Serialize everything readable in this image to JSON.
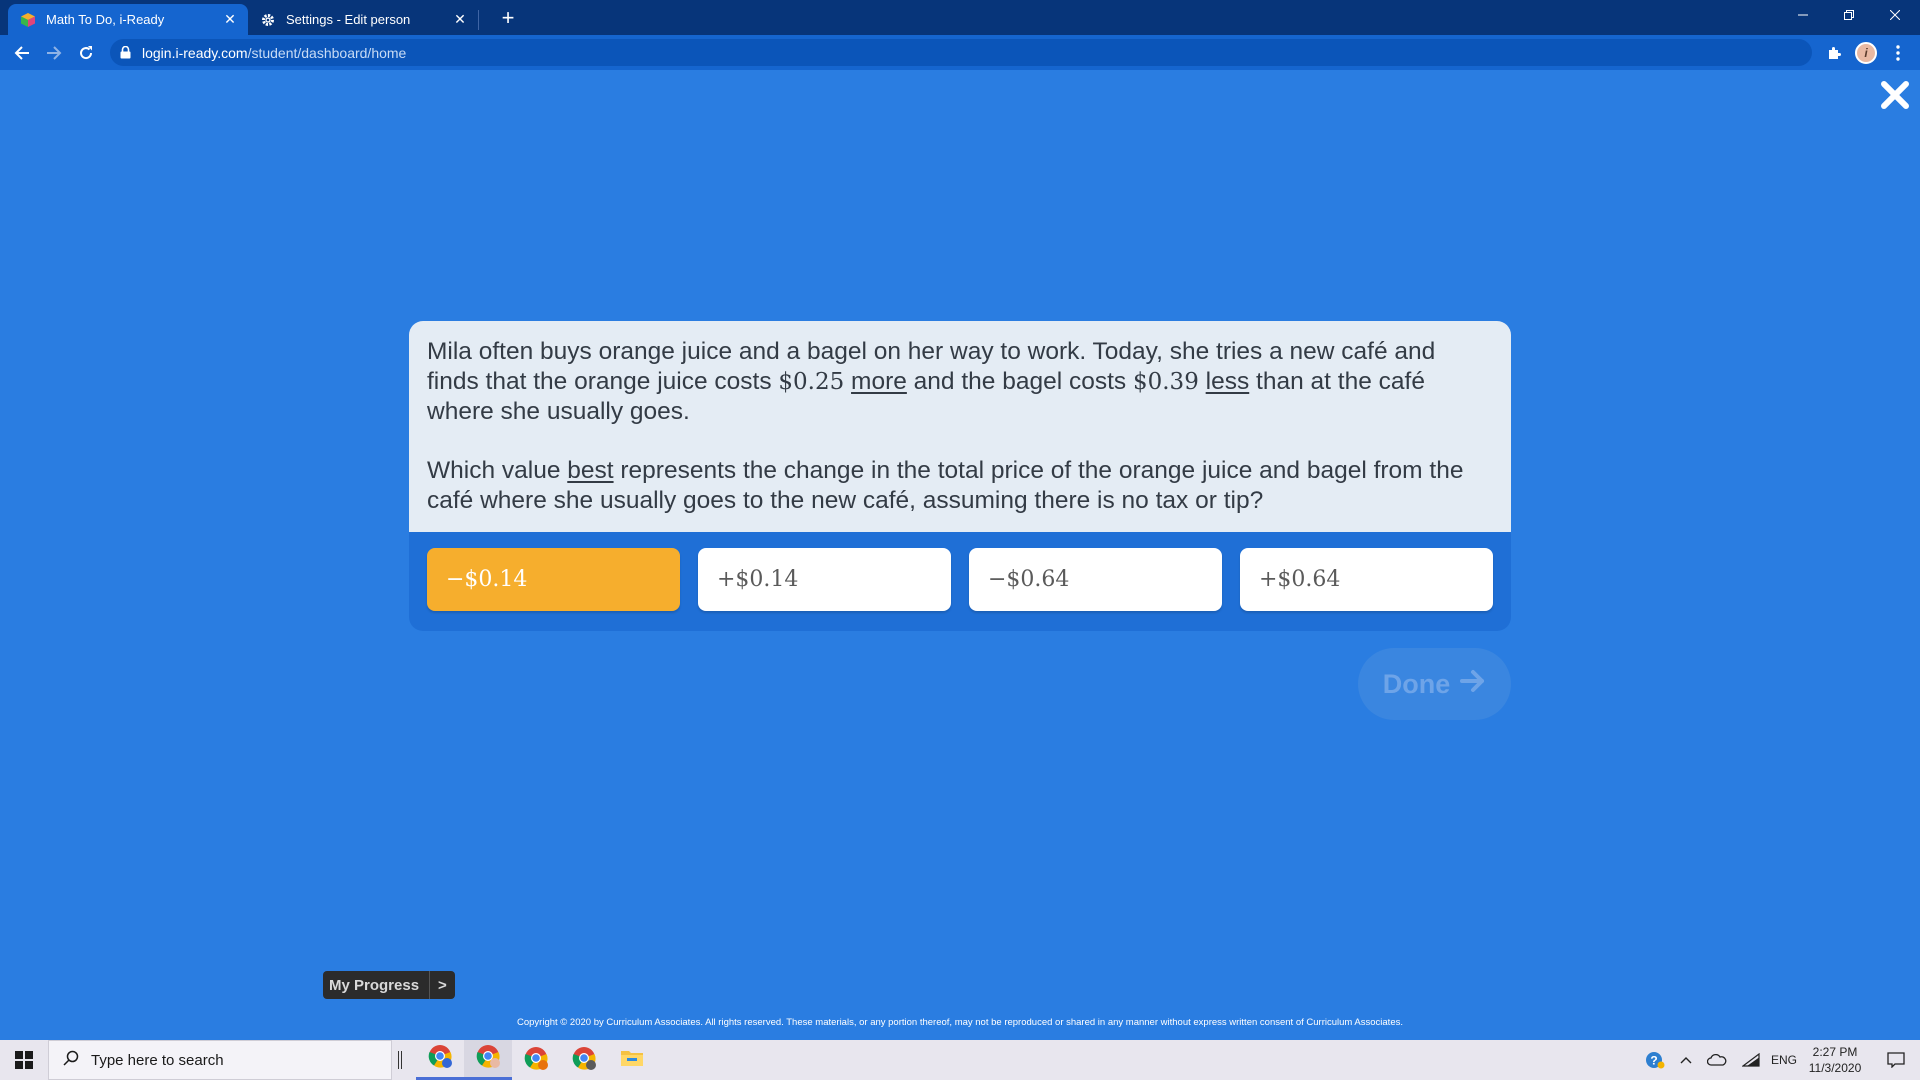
{
  "browser": {
    "tabs": [
      {
        "title": "Math To Do, i-Ready",
        "active": true,
        "favicon": "i-ready-cube-icon"
      },
      {
        "title": "Settings - Edit person",
        "active": false,
        "favicon": "gear-icon"
      }
    ],
    "address": {
      "domain": "login.i-ready.com",
      "path": "/student/dashboard/home"
    },
    "profile_initial": "i"
  },
  "question": {
    "p1_a": "Mila often buys orange juice and a bagel on her way to work. Today, she tries a new café and finds that the orange juice costs ",
    "p1_v1": "$0.25",
    "p1_u1": "more",
    "p1_b": " and the bagel costs ",
    "p1_v2": "$0.39",
    "p1_u2": "less",
    "p1_c": " than at the café where she usually goes.",
    "p2_a": "Which value ",
    "p2_u": "best",
    "p2_b": " represents the change in the total price of the orange juice and bagel from the café where she usually goes to the new café, assuming there is no tax or tip?"
  },
  "answers": [
    {
      "label": "−$0.14",
      "selected": true
    },
    {
      "label": "+$0.14",
      "selected": false
    },
    {
      "label": "−$0.64",
      "selected": false
    },
    {
      "label": "+$0.64",
      "selected": false
    }
  ],
  "done_label": "Done",
  "my_progress": {
    "label": "My Progress",
    "arrow": ">"
  },
  "copyright": "Copyright © 2020 by Curriculum Associates. All rights reserved. These materials, or any portion thereof, may not be reproduced or shared in any manner without express written consent of Curriculum Associates.",
  "taskbar": {
    "search_placeholder": "Type here to search",
    "language": "ENG",
    "time": "2:27 PM",
    "date": "11/3/2020"
  },
  "colors": {
    "page_bg": "#2a7de1",
    "selected_answer": "#f6ae2d",
    "question_bg": "#e4ecf4"
  }
}
